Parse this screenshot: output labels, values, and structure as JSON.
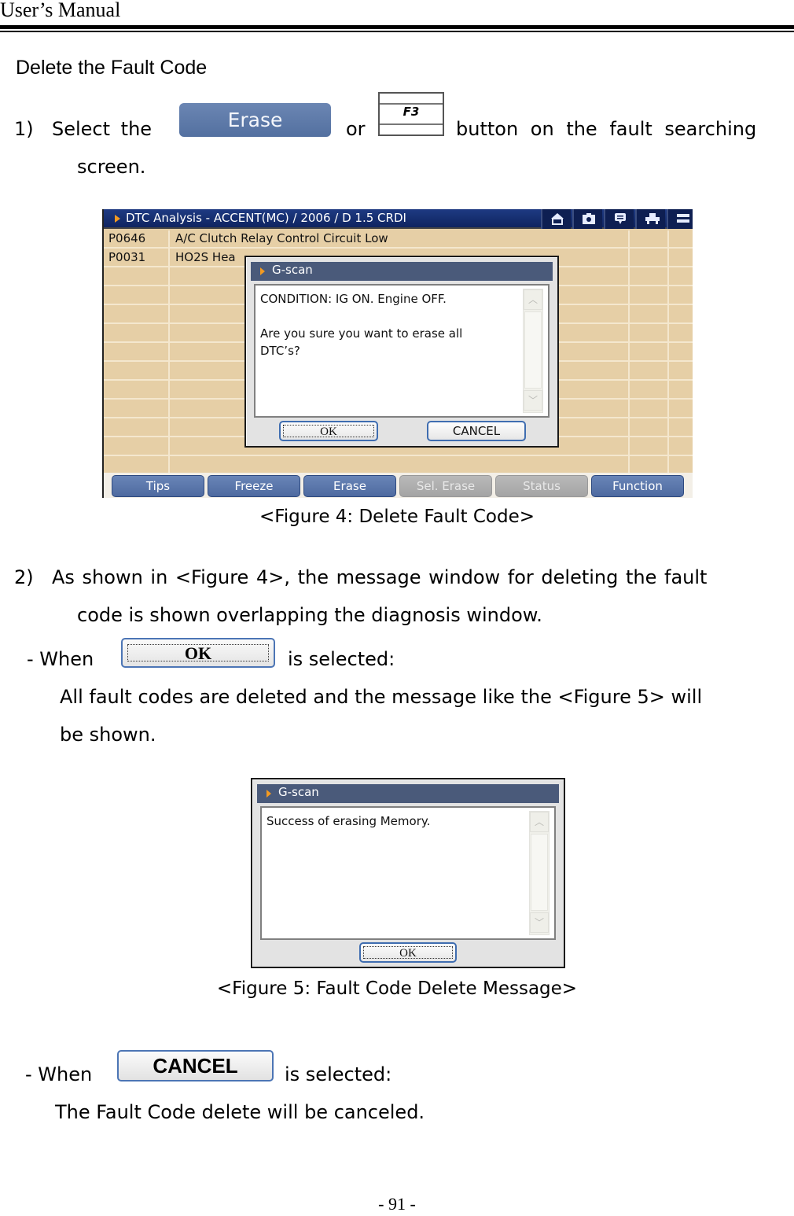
{
  "header": {
    "title": "User’s Manual"
  },
  "section": {
    "title": "Delete the Fault Code"
  },
  "step1": {
    "number": "1)",
    "text_before": "Select  the",
    "erase_button_label": "Erase",
    "text_or": "or",
    "f3_key_label": "F3",
    "text_after": "button  on  the  fault  searching",
    "continuation": "screen."
  },
  "figure4": {
    "titlebar": {
      "title": "DTC Analysis - ACCENT(MC) / 2006 / D 1.5 CRDI",
      "icons": [
        "home-icon",
        "camera-icon",
        "message-icon",
        "vehicle-icon",
        "menu-icon"
      ]
    },
    "dtc_rows": [
      {
        "code": "P0646",
        "description": "A/C Clutch Relay Control Circuit Low"
      },
      {
        "code": "P0031",
        "description": "HO2S Hea"
      }
    ],
    "dialog": {
      "title": "G-scan",
      "message": "CONDITION: IG ON. Engine OFF.\n\nAre you sure you want to erase all\nDTC’s?",
      "ok_label": "OK",
      "cancel_label": "CANCEL"
    },
    "function_buttons": [
      {
        "label": "Tips",
        "enabled": true
      },
      {
        "label": "Freeze",
        "enabled": true
      },
      {
        "label": "Erase",
        "enabled": true
      },
      {
        "label": "Sel. Erase",
        "enabled": false
      },
      {
        "label": "Status",
        "enabled": false
      },
      {
        "label": "Function",
        "enabled": true
      }
    ],
    "caption": "<Figure 4: Delete Fault Code>"
  },
  "step2": {
    "number": "2)",
    "line1": "As shown in <Figure 4>, the message window for deleting the fault",
    "line2": "code is shown overlapping the diagnosis window."
  },
  "when_ok": {
    "prefix": "- When",
    "button_label": "OK",
    "suffix": "is selected:",
    "line1": "All fault codes are deleted and the message like the <Figure 5> will",
    "line2": "be shown."
  },
  "figure5": {
    "dialog": {
      "title": "G-scan",
      "message": "Success of erasing Memory.",
      "ok_label": "OK"
    },
    "caption": "<Figure 5: Fault Code Delete Message>"
  },
  "when_cancel": {
    "prefix": "- When",
    "button_label": "CANCEL",
    "suffix": "is selected:",
    "line1": "The Fault Code delete will be canceled."
  },
  "footer": {
    "page_number": "- 91 -"
  },
  "colors": {
    "titlebar": "#132a6e",
    "grid_background": "#e6cfa6",
    "function_button": "#5a76aa",
    "disabled_button": "#b0b0b0",
    "dialog_title": "#4a5a7a",
    "accent_arrow": "#f39a21"
  }
}
